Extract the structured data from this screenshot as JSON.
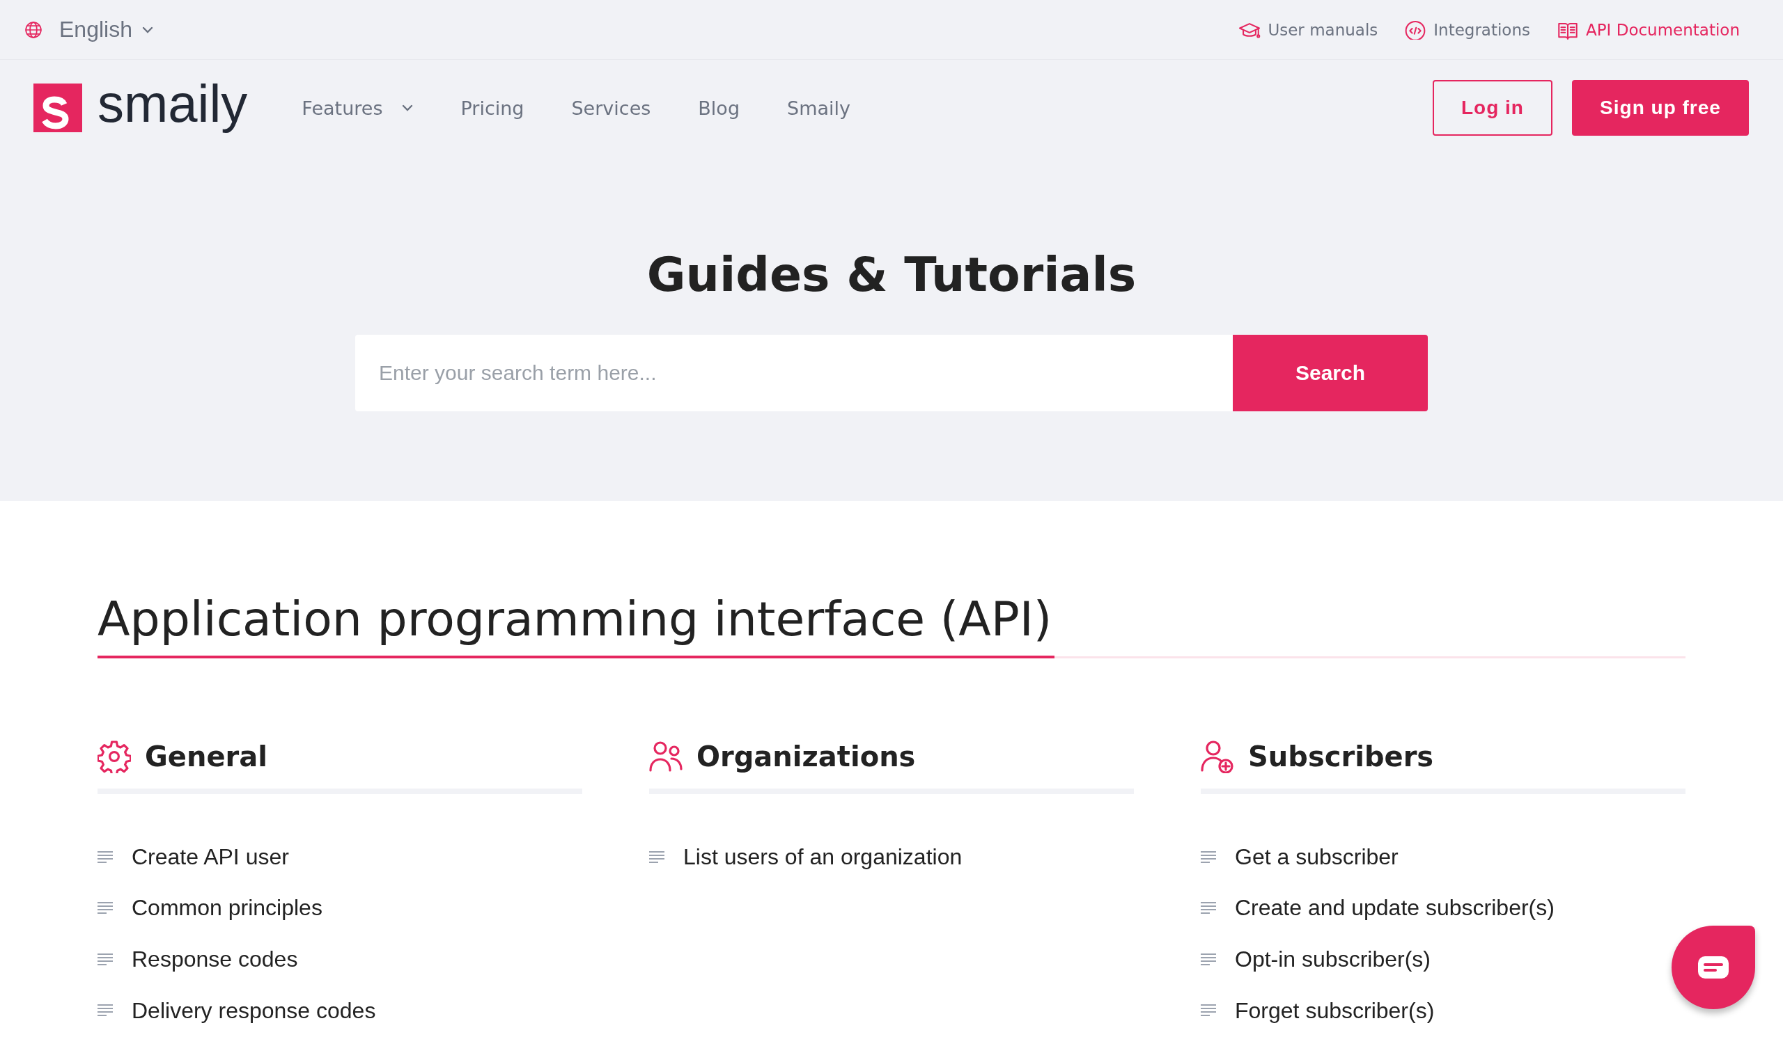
{
  "top_bar": {
    "language": "English",
    "links": [
      {
        "kind": "manuals",
        "label": "User manuals",
        "selected": false
      },
      {
        "kind": "integrations",
        "label": "Integrations",
        "selected": false
      },
      {
        "kind": "api",
        "label": "API Documentation",
        "selected": true
      }
    ]
  },
  "nav": {
    "logo": "smaily",
    "items": [
      {
        "label": "Features",
        "dropdown": true
      },
      {
        "label": "Pricing",
        "dropdown": false
      },
      {
        "label": "Services",
        "dropdown": false
      },
      {
        "label": "Blog",
        "dropdown": false
      },
      {
        "label": "Smaily",
        "dropdown": false
      }
    ],
    "login": "Log in",
    "signup": "Sign up free"
  },
  "hero": {
    "title": "Guides & Tutorials",
    "search": {
      "placeholder": "Enter your search term here...",
      "button": "Search"
    }
  },
  "section": {
    "title": "Application programming interface (API)",
    "columns": [
      {
        "kind": "gear",
        "title": "General",
        "items": [
          "Create API user",
          "Common principles",
          "Response codes",
          "Delivery response codes"
        ]
      },
      {
        "kind": "people",
        "title": "Organizations",
        "items": [
          "List users of an organization"
        ]
      },
      {
        "kind": "person-add",
        "title": "Subscribers",
        "items": [
          "Get a subscriber",
          "Create and update subscriber(s)",
          "Opt-in subscriber(s)",
          "Forget subscriber(s)"
        ]
      }
    ]
  }
}
